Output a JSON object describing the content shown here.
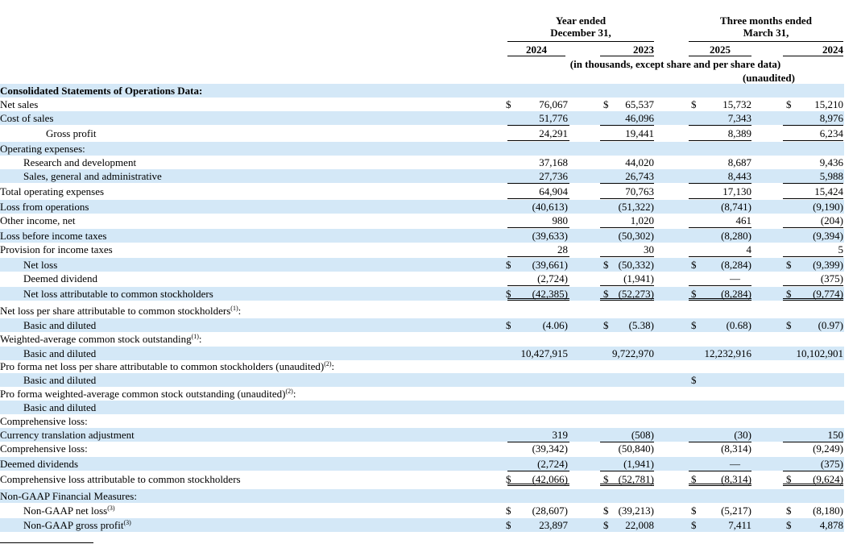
{
  "header": {
    "group_year": "Year ended\nDecember 31,",
    "group_quarter": "Three months ended\nMarch 31,",
    "col_2024a": "2024",
    "col_2023": "2023",
    "col_2025": "2025",
    "col_2024b": "2024",
    "units": "(in thousands, except share and per share data)",
    "unaudited": "(unaudited)"
  },
  "rows": [
    {
      "label": "Consolidated Statements of Operations Data:",
      "bold": true,
      "shade": true,
      "indent": 0
    },
    {
      "label": "Net sales",
      "shade": false,
      "indent": 0,
      "cur": true,
      "vals": [
        "76,067",
        "65,537",
        "15,732",
        "15,210"
      ]
    },
    {
      "label": "Cost of sales",
      "shade": true,
      "indent": 0,
      "vals": [
        "51,776",
        "46,096",
        "7,343",
        "8,976"
      ],
      "line": "single"
    },
    {
      "label": "Gross profit",
      "shade": false,
      "indent": 2,
      "vals": [
        "24,291",
        "19,441",
        "8,389",
        "6,234"
      ],
      "line": "single"
    },
    {
      "label": "Operating expenses:",
      "shade": true,
      "indent": 0
    },
    {
      "label": "Research and development",
      "shade": false,
      "indent": 1,
      "vals": [
        "37,168",
        "44,020",
        "8,687",
        "9,436"
      ]
    },
    {
      "label": "Sales, general and administrative",
      "shade": true,
      "indent": 1,
      "vals": [
        "27,736",
        "26,743",
        "8,443",
        "5,988"
      ],
      "line": "single"
    },
    {
      "label": "Total operating expenses",
      "shade": false,
      "indent": 0,
      "vals": [
        "64,904",
        "70,763",
        "17,130",
        "15,424"
      ],
      "line": "single"
    },
    {
      "label": "Loss from operations",
      "shade": true,
      "indent": 0,
      "vals": [
        "(40,613)",
        "(51,322)",
        "(8,741)",
        "(9,190)"
      ]
    },
    {
      "label": "Other income, net",
      "shade": false,
      "indent": 0,
      "vals": [
        "980",
        "1,020",
        "461",
        "(204)"
      ],
      "line": "single"
    },
    {
      "label": "Loss before income taxes",
      "shade": true,
      "indent": 0,
      "vals": [
        "(39,633)",
        "(50,302)",
        "(8,280)",
        "(9,394)"
      ]
    },
    {
      "label": "Provision for income taxes",
      "shade": false,
      "indent": 0,
      "vals": [
        "28",
        "30",
        "4",
        "5"
      ],
      "line": "single"
    },
    {
      "label": "Net loss",
      "shade": true,
      "indent": 1,
      "cur": true,
      "vals": [
        "(39,661)",
        "(50,332)",
        "(8,284)",
        "(9,399)"
      ]
    },
    {
      "label": "Deemed dividend",
      "shade": false,
      "indent": 1,
      "vals": [
        "(2,724)",
        "(1,941)",
        "—",
        "(375)"
      ],
      "line": "single"
    },
    {
      "label": "Net loss attributable to common stockholders",
      "shade": true,
      "indent": 1,
      "cur": true,
      "vals": [
        "(42,385)",
        "(52,273)",
        "(8,284)",
        "(9,774)"
      ],
      "line": "double"
    },
    {
      "label": "Net loss per share attributable to common stockholders",
      "sup": "(1)",
      "suffix": ":",
      "shade": false,
      "indent": 0
    },
    {
      "label": "Basic and diluted",
      "shade": true,
      "indent": 1,
      "cur": true,
      "vals": [
        "(4.06)",
        "(5.38)",
        "(0.68)",
        "(0.97)"
      ]
    },
    {
      "label": "Weighted-average common stock outstanding",
      "sup": "(1)",
      "suffix": ":",
      "shade": false,
      "indent": 0
    },
    {
      "label": "Basic and diluted",
      "shade": true,
      "indent": 1,
      "vals": [
        "10,427,915",
        "9,722,970",
        "12,232,916",
        "10,102,901"
      ]
    },
    {
      "label": "Pro forma net loss per share attributable to common stockholders (unaudited)",
      "sup": "(2)",
      "suffix": ":",
      "shade": false,
      "indent": 0
    },
    {
      "label": "Basic and diluted",
      "shade": true,
      "indent": 1,
      "cur3": true
    },
    {
      "label": "Pro forma weighted-average common stock outstanding (unaudited)",
      "sup": "(2)",
      "suffix": ":",
      "shade": false,
      "indent": 0
    },
    {
      "label": "Basic and diluted",
      "shade": true,
      "indent": 1
    },
    {
      "label": "Comprehensive loss:",
      "shade": false,
      "indent": 0
    },
    {
      "label": "Currency translation adjustment",
      "shade": true,
      "indent": 0,
      "vals": [
        "319",
        "(508)",
        "(30)",
        "150"
      ],
      "line": "single"
    },
    {
      "label": "Comprehensive loss:",
      "shade": false,
      "indent": 0,
      "vals": [
        "(39,342)",
        "(50,840)",
        "(8,314)",
        "(9,249)"
      ]
    },
    {
      "label": "Deemed dividends",
      "shade": true,
      "indent": 0,
      "vals": [
        "(2,724)",
        "(1,941)",
        "—",
        "(375)"
      ],
      "line": "single"
    },
    {
      "label": "Comprehensive loss attributable to common stockholders",
      "shade": false,
      "indent": 0,
      "cur": true,
      "vals": [
        "(42,066)",
        "(52,781)",
        "(8,314)",
        "(9,624)"
      ],
      "line": "double"
    },
    {
      "label": "Non-GAAP Financial Measures:",
      "shade": true,
      "indent": 0
    },
    {
      "label": "Non-GAAP net loss",
      "sup": "(3)",
      "shade": false,
      "indent": 1,
      "cur": true,
      "vals": [
        "(28,607)",
        "(39,213)",
        "(5,217)",
        "(8,180)"
      ]
    },
    {
      "label": "Non-GAAP gross profit",
      "sup": "(3)",
      "shade": true,
      "indent": 1,
      "cur": true,
      "vals": [
        "23,897",
        "22,008",
        "7,411",
        "4,878"
      ]
    }
  ],
  "currency_symbol": "$"
}
